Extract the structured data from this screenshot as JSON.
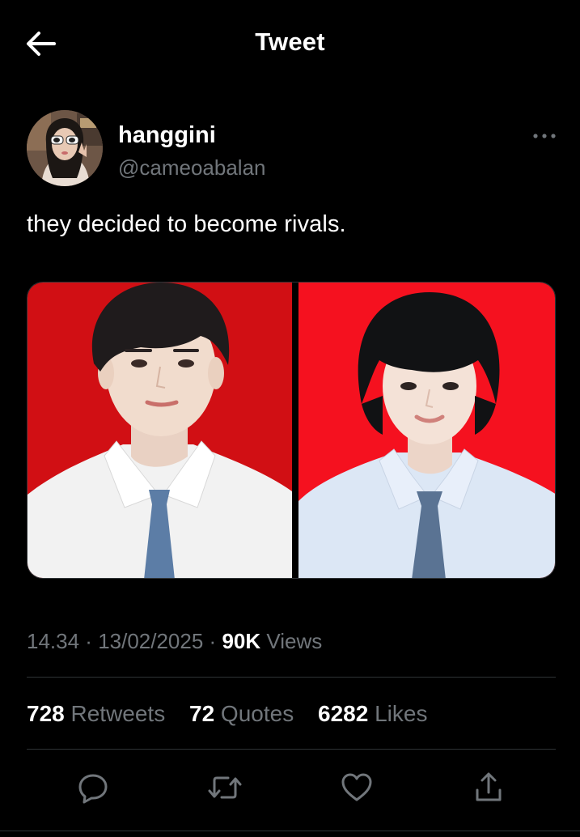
{
  "header": {
    "title": "Tweet",
    "back_icon": "arrow-left-icon"
  },
  "author": {
    "name": "hanggini",
    "handle": "@cameoabalan",
    "more_icon": "more-horizontal-icon"
  },
  "tweet": {
    "text": "they decided to become rivals.",
    "media": [
      {
        "description_icon": "portrait-photo",
        "background": "#d10f14",
        "tie_color": "#5c7da6"
      },
      {
        "description_icon": "portrait-photo",
        "background": "#f5111f",
        "tie_color": "#5a7393"
      }
    ]
  },
  "meta": {
    "time": "14.34",
    "separator1": " · ",
    "date": "13/02/2025",
    "separator2": " · ",
    "views_count": "90K",
    "views_label": " Views"
  },
  "stats": {
    "retweets_count": "728",
    "retweets_label": " Retweets",
    "quotes_count": "72",
    "quotes_label": " Quotes",
    "likes_count": "6282",
    "likes_label": " Likes"
  },
  "actions": {
    "reply_icon": "reply-icon",
    "retweet_icon": "retweet-icon",
    "like_icon": "heart-icon",
    "share_icon": "share-icon"
  },
  "colors": {
    "background": "#000000",
    "text_primary": "#ffffff",
    "text_secondary": "#71767b",
    "divider": "#2f3336"
  }
}
